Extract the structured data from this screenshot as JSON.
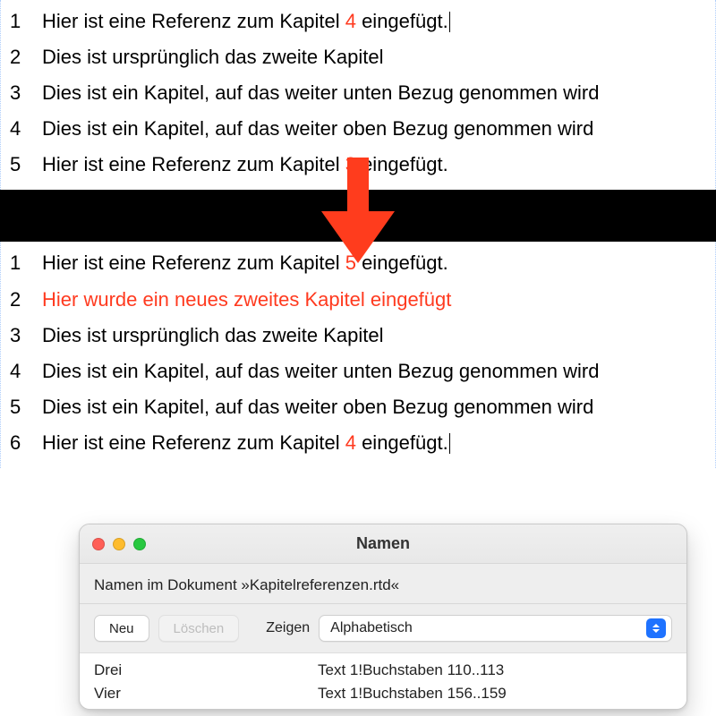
{
  "top_list": [
    {
      "num": "1",
      "pre": "Hier ist eine Referenz zum Kapitel ",
      "ref": "4",
      "post": " eingefügt.",
      "caret": true
    },
    {
      "num": "2",
      "pre": "Dies ist ursprünglich das zweite Kapitel",
      "ref": "",
      "post": ""
    },
    {
      "num": "3",
      "pre": "Dies ist ein Kapitel, auf das weiter unten Bezug genommen wird",
      "ref": "",
      "post": ""
    },
    {
      "num": "4",
      "pre": "Dies ist ein Kapitel, auf das weiter oben Bezug genommen wird",
      "ref": "",
      "post": ""
    },
    {
      "num": "5",
      "pre": "Hier ist eine Referenz zum Kapitel ",
      "ref": "3",
      "post": " eingefügt."
    }
  ],
  "bottom_list": [
    {
      "num": "1",
      "pre": "Hier ist eine Referenz zum Kapitel ",
      "ref": "5",
      "post": " eingefügt."
    },
    {
      "num": "2",
      "full_red": "Hier wurde ein neues zweites Kapitel eingefügt"
    },
    {
      "num": "3",
      "pre": "Dies ist ursprünglich das zweite Kapitel",
      "ref": "",
      "post": ""
    },
    {
      "num": "4",
      "pre": "Dies ist ein Kapitel, auf das weiter unten Bezug genommen wird",
      "ref": "",
      "post": ""
    },
    {
      "num": "5",
      "pre": "Dies ist ein Kapitel, auf das weiter oben Bezug genommen wird",
      "ref": "",
      "post": ""
    },
    {
      "num": "6",
      "pre": "Hier ist eine Referenz zum Kapitel ",
      "ref": "4",
      "post": " eingefügt.",
      "caret": true
    }
  ],
  "panel": {
    "title": "Namen",
    "subtitle": "Namen im Dokument »Kapitelreferenzen.rtd«",
    "btn_new": "Neu",
    "btn_delete": "Löschen",
    "lbl_show": "Zeigen",
    "select_value": "Alphabetisch",
    "rows": [
      {
        "name": "Drei",
        "loc": "Text 1!Buchstaben 110..113"
      },
      {
        "name": "Vier",
        "loc": "Text 1!Buchstaben 156..159"
      }
    ]
  }
}
